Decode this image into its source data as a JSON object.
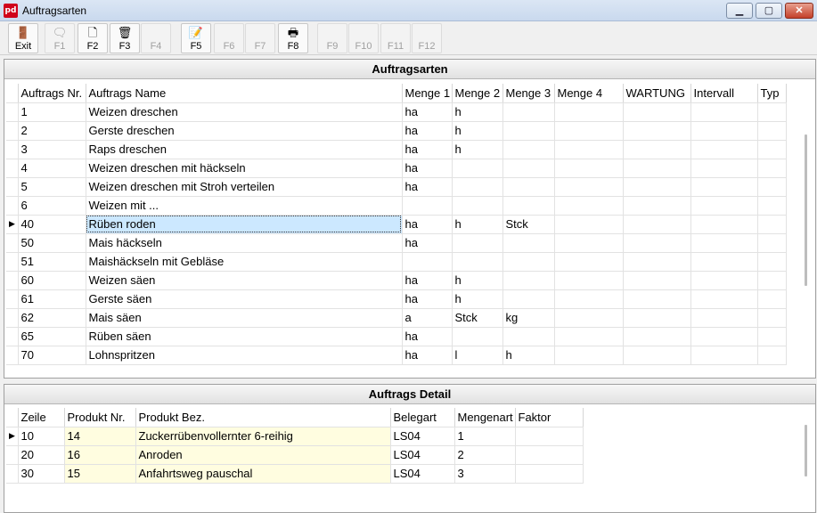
{
  "window": {
    "icon_text": "pd",
    "title": "Auftragsarten",
    "controls": {
      "minimize": "▁",
      "maximize": "▢",
      "close": "✕"
    }
  },
  "toolbar": {
    "buttons": [
      {
        "label": "Exit",
        "icon": "exit-door-icon",
        "enabled": true
      },
      {
        "label": "F1",
        "icon": "speech-bubble-icon",
        "enabled": false
      },
      {
        "label": "F2",
        "icon": "new-document-icon",
        "enabled": true
      },
      {
        "label": "F3",
        "icon": "trash-icon",
        "enabled": true
      },
      {
        "label": "F4",
        "icon": "",
        "enabled": false
      },
      {
        "label": "F5",
        "icon": "edit-document-icon",
        "enabled": true
      },
      {
        "label": "F6",
        "icon": "",
        "enabled": false
      },
      {
        "label": "F7",
        "icon": "",
        "enabled": false
      },
      {
        "label": "F8",
        "icon": "printer-icon",
        "enabled": true
      },
      {
        "label": "F9",
        "icon": "",
        "enabled": false
      },
      {
        "label": "F10",
        "icon": "",
        "enabled": false
      },
      {
        "label": "F11",
        "icon": "",
        "enabled": false
      },
      {
        "label": "F12",
        "icon": "",
        "enabled": false
      }
    ]
  },
  "auftragsarten": {
    "title": "Auftragsarten",
    "columns": [
      "Auftrags Nr.",
      "Auftrags Name",
      "Menge 1",
      "Menge 2",
      "Menge 3",
      "Menge 4",
      "WARTUNG",
      "Intervall",
      "Typ"
    ],
    "selected_row": 6,
    "rows": [
      [
        "1",
        "Weizen dreschen",
        "ha",
        "h",
        "",
        "",
        "",
        "",
        ""
      ],
      [
        "2",
        "Gerste dreschen",
        "ha",
        "h",
        "",
        "",
        "",
        "",
        ""
      ],
      [
        "3",
        "Raps dreschen",
        "ha",
        "h",
        "",
        "",
        "",
        "",
        ""
      ],
      [
        "4",
        "Weizen dreschen mit häckseln",
        "ha",
        "",
        "",
        "",
        "",
        "",
        ""
      ],
      [
        "5",
        "Weizen dreschen mit Stroh verteilen",
        "ha",
        "",
        "",
        "",
        "",
        "",
        ""
      ],
      [
        "6",
        "Weizen mit ...",
        "",
        "",
        "",
        "",
        "",
        "",
        ""
      ],
      [
        "40",
        "Rüben roden",
        "ha",
        "h",
        "Stck",
        "",
        "",
        "",
        ""
      ],
      [
        "50",
        "Mais häckseln",
        "ha",
        "",
        "",
        "",
        "",
        "",
        ""
      ],
      [
        "51",
        "Maishäckseln mit Gebläse",
        "",
        "",
        "",
        "",
        "",
        "",
        ""
      ],
      [
        "60",
        "Weizen säen",
        "ha",
        "h",
        "",
        "",
        "",
        "",
        ""
      ],
      [
        "61",
        "Gerste säen",
        "ha",
        "h",
        "",
        "",
        "",
        "",
        ""
      ],
      [
        "62",
        "Mais säen",
        "a",
        "Stck",
        "kg",
        "",
        "",
        "",
        ""
      ],
      [
        "65",
        "Rüben säen",
        "ha",
        "",
        "",
        "",
        "",
        "",
        ""
      ],
      [
        "70",
        "Lohnspritzen",
        "ha",
        "l",
        "h",
        "",
        "",
        "",
        ""
      ]
    ]
  },
  "auftrags_detail": {
    "title": "Auftrags Detail",
    "columns": [
      "Zeile",
      "Produkt Nr.",
      "Produkt Bez.",
      "Belegart",
      "Mengenart",
      "Faktor"
    ],
    "selected_row": 0,
    "rows": [
      [
        "10",
        "14",
        "Zuckerrübenvollernter 6-reihig",
        "LS04",
        "1",
        ""
      ],
      [
        "20",
        "16",
        "Anroden",
        "LS04",
        "2",
        ""
      ],
      [
        "30",
        "15",
        "Anfahrtsweg pauschal",
        "LS04",
        "3",
        ""
      ]
    ]
  }
}
